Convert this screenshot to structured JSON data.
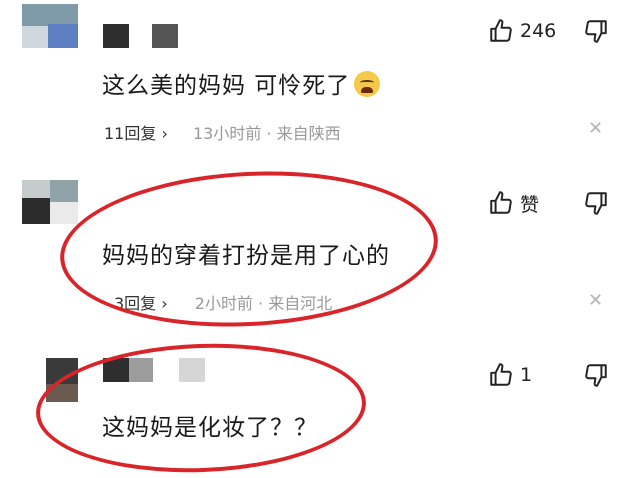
{
  "comments": [
    {
      "text": "这么美的妈妈 可怜死了",
      "emoji": "crying-face-emoji",
      "replies": "11回复",
      "time": "13小时前 · 来自陕西",
      "likes": "246"
    },
    {
      "text": "妈妈的穿着打扮是用了心的",
      "replies": "3回复",
      "time": "2小时前 · 来自河北",
      "likes": "赞"
    },
    {
      "text": "这妈妈是化妆了？？",
      "likes": "1"
    }
  ],
  "colors": {
    "annotation_circle": "#d9252a",
    "meta_text": "#999999"
  }
}
